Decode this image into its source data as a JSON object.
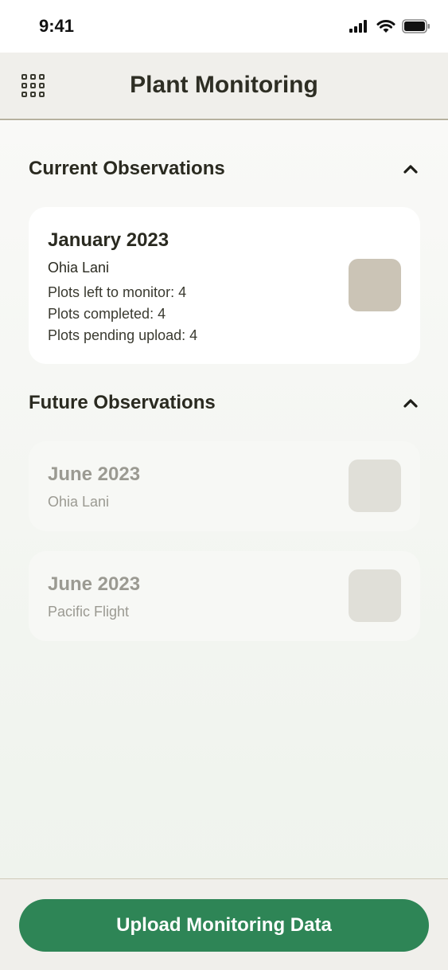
{
  "status_bar": {
    "time": "9:41"
  },
  "header": {
    "title": "Plant Monitoring"
  },
  "current": {
    "title": "Current Observations",
    "cards": [
      {
        "title": "January 2023",
        "site": "Ohia Lani",
        "lines": [
          "Plots left to monitor: 4",
          "Plots completed: 4",
          "Plots pending upload: 4"
        ]
      }
    ]
  },
  "future": {
    "title": "Future Observations",
    "cards": [
      {
        "title": "June 2023",
        "site": "Ohia Lani"
      },
      {
        "title": "June 2023",
        "site": "Pacific Flight"
      }
    ]
  },
  "footer": {
    "upload_label": "Upload Monitoring Data"
  },
  "colors": {
    "accent": "#2e8556",
    "header_bg": "#f0efeb",
    "thumb": "#cbc4b6"
  },
  "icons": [
    "signal-icon",
    "wifi-icon",
    "battery-icon",
    "grid-menu-icon",
    "chevron-up-icon"
  ]
}
